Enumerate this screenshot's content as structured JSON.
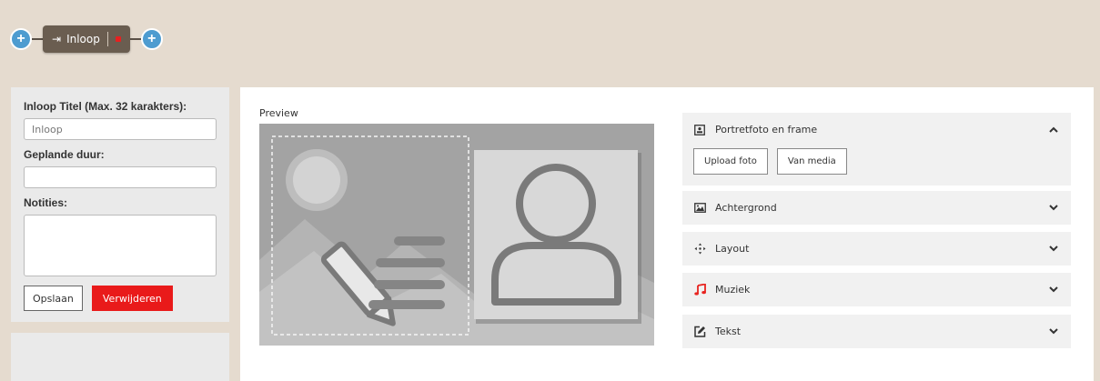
{
  "flow": {
    "step_label": "Inloop"
  },
  "form": {
    "title_label": "Inloop Titel (Max. 32 karakters):",
    "title_value": "Inloop",
    "duration_label": "Geplande duur:",
    "duration_value": "",
    "notes_label": "Notities:",
    "save_label": "Opslaan",
    "delete_label": "Verwijderen"
  },
  "preview": {
    "label": "Preview"
  },
  "sections": {
    "portrait": {
      "title": "Portretfoto en frame",
      "upload_label": "Upload foto",
      "media_label": "Van media",
      "expanded": true
    },
    "background": {
      "title": "Achtergrond"
    },
    "layout": {
      "title": "Layout"
    },
    "music": {
      "title": "Muziek"
    },
    "text": {
      "title": "Tekst"
    }
  },
  "colors": {
    "background": "#e5dbcf",
    "plus_button": "#4e9cd0",
    "step_chip": "#6a5d50",
    "delete_button": "#e91a1a",
    "music_icon": "#e8231f"
  },
  "icons": {
    "add": "add-icon",
    "enter": "sign-in-icon",
    "portrait": "portrait-icon",
    "background": "image-icon",
    "layout": "move-arrows-icon",
    "music": "music-note-icon",
    "text": "edit-icon",
    "chevron_up": "chevron-up-icon",
    "chevron_down": "chevron-down-icon"
  }
}
